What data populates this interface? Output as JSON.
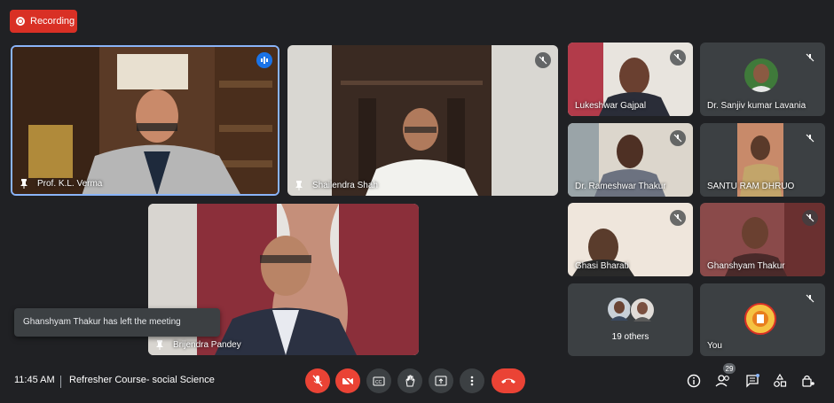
{
  "recording": {
    "label": "Recording"
  },
  "tiles": {
    "main1": {
      "name": "Prof. K.L. Verma"
    },
    "main2": {
      "name": "Shailendra Shah"
    },
    "main3": {
      "name": "Brijendra Pandey"
    },
    "t1": {
      "name": "Lukeshwar Gajpal"
    },
    "t2": {
      "name": "Dr. Sanjiv kumar Lavania"
    },
    "t3": {
      "name": "Dr. Rameshwar Thakur"
    },
    "t4": {
      "name": "SANTU RAM DHRUO"
    },
    "t5": {
      "name": "Ghasi Bharati"
    },
    "t6": {
      "name": "Ghanshyam Thakur"
    },
    "others": {
      "count_label": "19 others"
    },
    "you": {
      "name": "You"
    }
  },
  "toast": {
    "message": "Ghanshyam Thakur has left the meeting"
  },
  "bottom_bar": {
    "time": "11:45 AM",
    "meeting_title": "Refresher Course- social Science",
    "participant_count": "29"
  },
  "colors": {
    "accent_red": "#ea4335",
    "accent_blue": "#1a73e8",
    "background": "#202124"
  }
}
